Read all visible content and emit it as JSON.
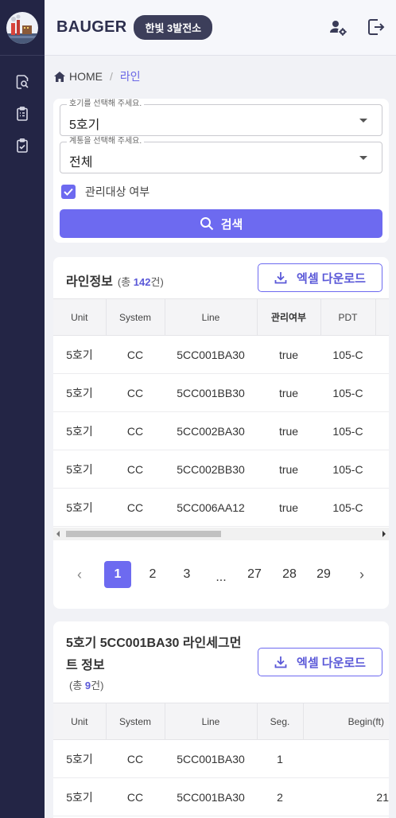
{
  "header": {
    "brand": "BAUGER",
    "plant": "한빛 3발전소"
  },
  "sidebar": {
    "items": [
      {
        "icon": "search-doc-icon"
      },
      {
        "icon": "clipboard-list-icon"
      },
      {
        "icon": "clipboard-check-icon"
      }
    ]
  },
  "breadcrumb": {
    "home": "HOME",
    "separator": "/",
    "current": "라인"
  },
  "filters": {
    "unit": {
      "legend": "호기를 선택해 주세요.",
      "value": "5호기"
    },
    "system": {
      "legend": "계통을 선택해 주세요.",
      "value": "전체"
    },
    "managed": {
      "label": "관리대상 여부",
      "checked": true
    },
    "search_label": "검색"
  },
  "line_info": {
    "title": "라인정보",
    "count_prefix": "(총 ",
    "count": "142",
    "count_suffix": "건)",
    "download_label": "엑셀 다운로드",
    "columns": [
      "Unit",
      "System",
      "Line",
      "관리여부",
      "PDT"
    ],
    "rows": [
      [
        "5호기",
        "CC",
        "5CC001BA30",
        "true",
        "105-C"
      ],
      [
        "5호기",
        "CC",
        "5CC001BB30",
        "true",
        "105-C"
      ],
      [
        "5호기",
        "CC",
        "5CC002BA30",
        "true",
        "105-C"
      ],
      [
        "5호기",
        "CC",
        "5CC002BB30",
        "true",
        "105-C"
      ],
      [
        "5호기",
        "CC",
        "5CC006AA12",
        "true",
        "105-C"
      ]
    ],
    "pagination": {
      "prev": "‹",
      "next": "›",
      "pages": [
        "1",
        "2",
        "3",
        "...",
        "27",
        "28",
        "29"
      ],
      "active": "1"
    }
  },
  "segment_info": {
    "title_line1": "5호기 5CC001BA30 라인세그먼",
    "title_line2": "트 정보",
    "count_prefix": "(총 ",
    "count": "9",
    "count_suffix": "건)",
    "download_label": "엑셀 다운로드",
    "columns": [
      "Unit",
      "System",
      "Line",
      "Seg.",
      "Begin(ft)"
    ],
    "rows": [
      [
        "5호기",
        "CC",
        "5CC001BA30",
        "1",
        ""
      ],
      [
        "5호기",
        "CC",
        "5CC001BA30",
        "2",
        "21"
      ]
    ]
  },
  "colors": {
    "accent": "#6d6af0",
    "sidebar": "#232545",
    "badge": "#3c3e5a"
  }
}
